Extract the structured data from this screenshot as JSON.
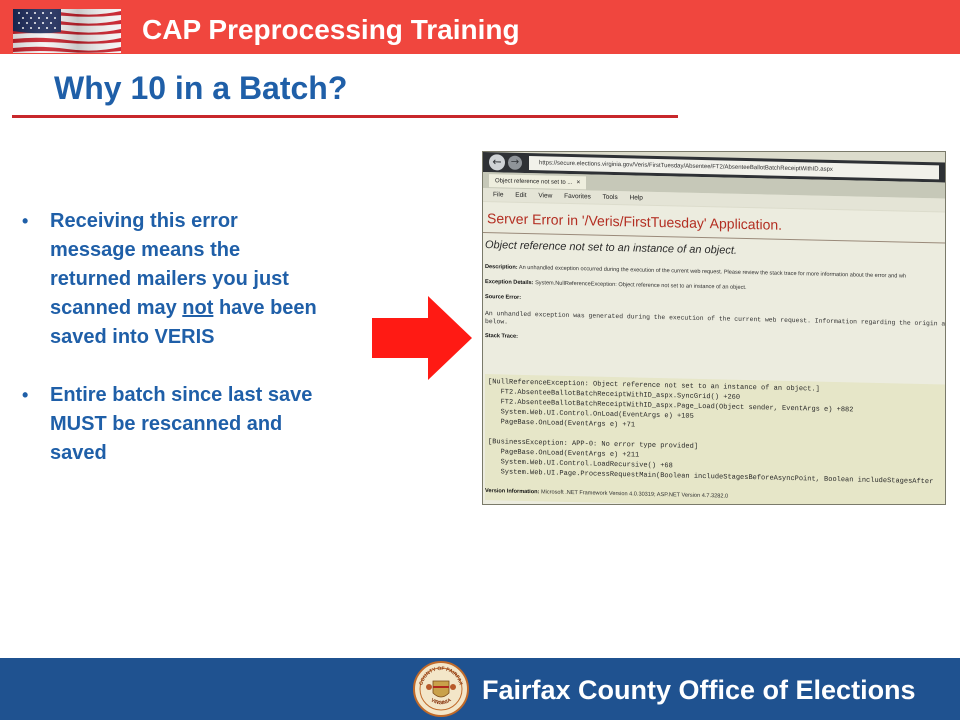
{
  "header": {
    "title": "CAP Preprocessing Training",
    "bar_color": "#f0463e"
  },
  "slide": {
    "title": "Why 10 in a Batch?",
    "title_color": "#1f5fa8",
    "rule_color": "#c8282b",
    "bullets": [
      {
        "text_before": "Receiving this error message means the returned mailers you just scanned may ",
        "emphasis": "not",
        "text_after": " have been saved into VERIS"
      },
      {
        "text": "Entire batch since last save MUST be rescanned and saved"
      }
    ],
    "bullet_glyph": "•",
    "arrow_color": "#ff1a14"
  },
  "screenshot_photo": {
    "url": "https://secure.elections.virginia.gov/Veris/FirstTuesday/Absentee/FT2/AbsenteeBallotBatchReceiptWithID.aspx",
    "tab_label": "Object reference not set to ...",
    "tab_close": "×",
    "menu": [
      "File",
      "Edit",
      "View",
      "Favorites",
      "Tools",
      "Help"
    ],
    "error_title": "Server Error in '/Veris/FirstTuesday' Application.",
    "error_subtitle": "Object reference not set to an instance of an object.",
    "description_label": "Description:",
    "description_text": "An unhandled exception occurred during the execution of the current web request. Please review the stack trace for more information about the error and wh",
    "exception_label": "Exception Details:",
    "exception_text": "System.NullReferenceException: Object reference not set to an instance of an object.",
    "source_error_label": "Source Error:",
    "source_error_text": "An unhandled exception was generated during the execution of the current web request. Information regarding the origin and loca",
    "source_error_text2": "below.",
    "stack_trace_label": "Stack Trace:",
    "stack_lines": [
      "[NullReferenceException: Object reference not set to an instance of an object.]",
      "   FT2.AbsenteeBallotBatchReceiptWithID_aspx.SyncGrid() +260",
      "   FT2.AbsenteeBallotBatchReceiptWithID_aspx.Page_Load(Object sender, EventArgs e) +882",
      "   System.Web.UI.Control.OnLoad(EventArgs e) +105",
      "   PageBase.OnLoad(EventArgs e) +71",
      "",
      "[BusinessException: APP-0: No error type provided]",
      "   PageBase.OnLoad(EventArgs e) +211",
      "   System.Web.UI.Control.LoadRecursive() +68",
      "   System.Web.UI.Page.ProcessRequestMain(Boolean includeStagesBeforeAsyncPoint, Boolean includeStagesAfter"
    ],
    "version_label": "Version Information:",
    "version_text": "Microsoft .NET Framework Version 4.0.30319; ASP.NET Version 4.7.3282.0"
  },
  "footer": {
    "title": "Fairfax County Office of Elections",
    "bar_color": "#1f5290",
    "seal_top_text": "COUNTY OF FAIRFAX",
    "seal_bottom_text": "VIRGINIA",
    "seal_year": "1742"
  }
}
